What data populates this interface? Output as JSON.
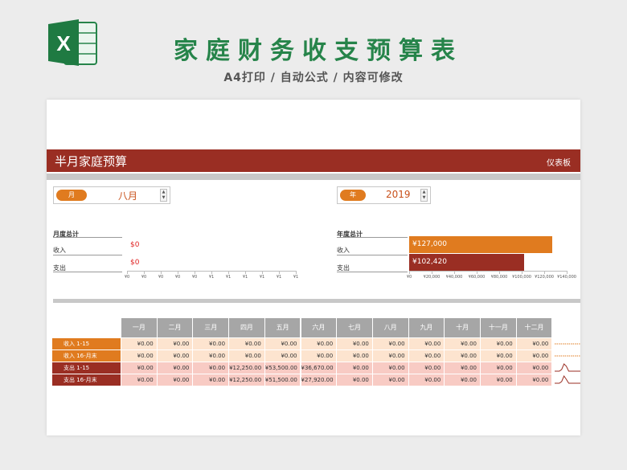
{
  "promo": {
    "logo_letter": "X",
    "title": "家庭财务收支预算表",
    "subtitle": "A4打印 / 自动公式 / 内容可修改",
    "brand_color": "#26844a"
  },
  "sheet": {
    "banner_title": "半月家庭预算",
    "banner_link": "仪表板",
    "accent_orange": "#e07b1f",
    "accent_red": "#9a2e23"
  },
  "month_selector": {
    "label": "月",
    "value": "八月"
  },
  "year_selector": {
    "label": "年",
    "value": "2019"
  },
  "month_summary": {
    "title": "月度总计",
    "rows": [
      {
        "label": "收入",
        "value": "$0"
      },
      {
        "label": "支出",
        "value": "$0"
      }
    ],
    "axis_ticks": [
      "¥0",
      "¥0",
      "¥0",
      "¥0",
      "¥0",
      "¥1",
      "¥1",
      "¥1",
      "¥1",
      "¥1",
      "¥1"
    ]
  },
  "year_summary": {
    "title": "年度总计",
    "rows": [
      {
        "label": "收入",
        "value": "¥127,000",
        "amount": 127000
      },
      {
        "label": "支出",
        "value": "¥102,420",
        "amount": 102420
      }
    ],
    "axis_ticks": [
      "¥0",
      "¥20,000",
      "¥40,000",
      "¥60,000",
      "¥80,000",
      "¥100,000",
      "¥120,000",
      "¥140,000"
    ],
    "axis_max": 140000
  },
  "table": {
    "months": [
      "一月",
      "二月",
      "三月",
      "四月",
      "五月",
      "六月",
      "七月",
      "八月",
      "九月",
      "十月",
      "十一月",
      "十二月"
    ],
    "rows": [
      {
        "label": "收入 1-15",
        "kind": "income",
        "values": [
          "¥0.00",
          "¥0.00",
          "¥0.00",
          "¥0.00",
          "¥0.00",
          "¥0.00",
          "¥0.00",
          "¥0.00",
          "¥0.00",
          "¥0.00",
          "¥0.00",
          "¥0.00"
        ]
      },
      {
        "label": "收入 16-月末",
        "kind": "income",
        "values": [
          "¥0.00",
          "¥0.00",
          "¥0.00",
          "¥0.00",
          "¥0.00",
          "¥0.00",
          "¥0.00",
          "¥0.00",
          "¥0.00",
          "¥0.00",
          "¥0.00",
          "¥0.00"
        ]
      },
      {
        "label": "支出 1-15",
        "kind": "expense",
        "values": [
          "¥0.00",
          "¥0.00",
          "¥0.00",
          "¥12,250.00",
          "¥53,500.00",
          "¥36,670.00",
          "¥0.00",
          "¥0.00",
          "¥0.00",
          "¥0.00",
          "¥0.00",
          "¥0.00"
        ]
      },
      {
        "label": "支出 16-月末",
        "kind": "expense",
        "values": [
          "¥0.00",
          "¥0.00",
          "¥0.00",
          "¥12,250.00",
          "¥51,500.00",
          "¥27,920.00",
          "¥0.00",
          "¥0.00",
          "¥0.00",
          "¥0.00",
          "¥0.00",
          "¥0.00"
        ]
      }
    ]
  }
}
